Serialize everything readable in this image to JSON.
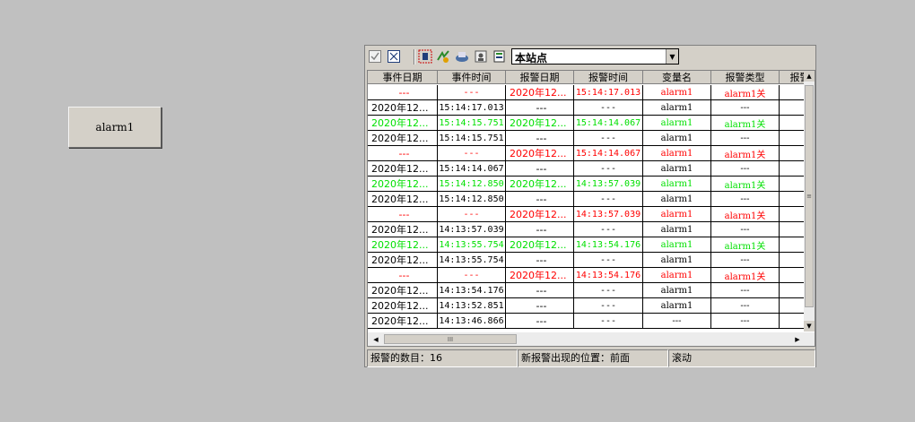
{
  "button": {
    "label": "alarm1"
  },
  "toolbar": {
    "station_value": "本站点",
    "icons": [
      "checkbox-checked-icon",
      "checkbox-cross-icon",
      "alarm-filter-icon",
      "acknowledge-icon",
      "print-icon",
      "user-icon",
      "export-icon"
    ]
  },
  "grid": {
    "columns": [
      "事件日期",
      "事件时间",
      "报警日期",
      "报警时间",
      "变量名",
      "报警类型",
      "报警"
    ],
    "rows": [
      {
        "color": "red",
        "cells": [
          "---",
          "---",
          "2020年12...",
          "15:14:17.013",
          "alarm1",
          "alarm1关"
        ]
      },
      {
        "color": "black",
        "cells": [
          "2020年12...",
          "15:14:17.013",
          "---",
          "---",
          "alarm1",
          "---"
        ]
      },
      {
        "color": "green",
        "cells": [
          "2020年12...",
          "15:14:15.751",
          "2020年12...",
          "15:14:14.067",
          "alarm1",
          "alarm1关"
        ]
      },
      {
        "color": "black",
        "cells": [
          "2020年12...",
          "15:14:15.751",
          "---",
          "---",
          "alarm1",
          "---"
        ]
      },
      {
        "color": "red",
        "cells": [
          "---",
          "---",
          "2020年12...",
          "15:14:14.067",
          "alarm1",
          "alarm1关"
        ]
      },
      {
        "color": "black",
        "cells": [
          "2020年12...",
          "15:14:14.067",
          "---",
          "---",
          "alarm1",
          "---"
        ]
      },
      {
        "color": "green",
        "cells": [
          "2020年12...",
          "15:14:12.850",
          "2020年12...",
          "14:13:57.039",
          "alarm1",
          "alarm1关"
        ]
      },
      {
        "color": "black",
        "cells": [
          "2020年12...",
          "15:14:12.850",
          "---",
          "---",
          "alarm1",
          "---"
        ]
      },
      {
        "color": "red",
        "cells": [
          "---",
          "---",
          "2020年12...",
          "14:13:57.039",
          "alarm1",
          "alarm1关"
        ]
      },
      {
        "color": "black",
        "cells": [
          "2020年12...",
          "14:13:57.039",
          "---",
          "---",
          "alarm1",
          "---"
        ]
      },
      {
        "color": "green",
        "cells": [
          "2020年12...",
          "14:13:55.754",
          "2020年12...",
          "14:13:54.176",
          "alarm1",
          "alarm1关"
        ]
      },
      {
        "color": "black",
        "cells": [
          "2020年12...",
          "14:13:55.754",
          "---",
          "---",
          "alarm1",
          "---"
        ]
      },
      {
        "color": "red",
        "cells": [
          "---",
          "---",
          "2020年12...",
          "14:13:54.176",
          "alarm1",
          "alarm1关"
        ]
      },
      {
        "color": "black",
        "cells": [
          "2020年12...",
          "14:13:54.176",
          "---",
          "---",
          "alarm1",
          "---"
        ]
      },
      {
        "color": "black",
        "cells": [
          "2020年12...",
          "14:13:52.851",
          "---",
          "---",
          "alarm1",
          "---"
        ]
      },
      {
        "color": "black",
        "cells": [
          "2020年12...",
          "14:13:46.866",
          "---",
          "---",
          "---",
          "---"
        ]
      }
    ],
    "hscroll_grip": "III",
    "vscroll_grip": "≡"
  },
  "status": {
    "count": "报警的数目：16",
    "position": "新报警出现的位置：前面",
    "mode": "滚动"
  },
  "colors": {
    "red": "#ff0000",
    "green": "#00e000",
    "black": "#000000"
  }
}
